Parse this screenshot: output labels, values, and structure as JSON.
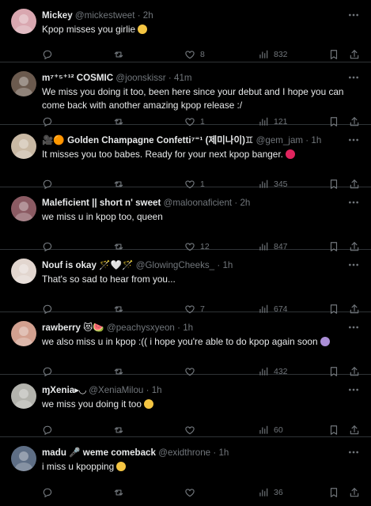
{
  "tweets": [
    {
      "name": "Mickey",
      "handle": "@mickestweet",
      "time": "2h",
      "text": "Kpop misses you girlie",
      "text_emoji": "pleading-face",
      "replies": "",
      "retweets": "",
      "likes": "8",
      "views": "832",
      "avatar_color": "#d9a7b0"
    },
    {
      "name": "m⁷⁺⁵⁺¹² COSMIC",
      "handle": "@joonskissr",
      "time": "41m",
      "text": "We miss you doing it too, been here since your debut and I hope you can come back with another amazing kpop release :/",
      "replies": "",
      "retweets": "",
      "likes": "1",
      "views": "121",
      "avatar_color": "#6b5a4e"
    },
    {
      "name": "🎥🟠 Golden Champagne Confetti⁷⁼¹ (제미나이)♊",
      "handle": "@gem_jam",
      "time": "1h",
      "text": "It misses you too babes. Ready for your next kpop banger.",
      "text_emoji": "heart-arrow",
      "replies": "",
      "retweets": "",
      "likes": "1",
      "views": "345",
      "avatar_color": "#c9b9a4"
    },
    {
      "name": "Maleficient || short n' sweet",
      "handle": "@maloonaficient",
      "time": "2h",
      "text": "we miss u in kpop too, queen",
      "replies": "",
      "retweets": "",
      "likes": "12",
      "views": "847",
      "avatar_color": "#8b5b63"
    },
    {
      "name": "Nouf is okay 🪄🤍🪄",
      "handle": "@GlowingCheeks_",
      "time": "1h",
      "text": "That's so sad to hear from you...",
      "replies": "",
      "retweets": "",
      "likes": "7",
      "views": "674",
      "avatar_color": "#e2d6cf"
    },
    {
      "name": "rawberry 😻🍉",
      "handle": "@peachysxyeon",
      "time": "1h",
      "text": "we also miss u in kpop :(( i hope you're able to do kpop again soon",
      "text_emoji": "purple-heart",
      "replies": "",
      "retweets": "",
      "likes": "",
      "views": "432",
      "avatar_color": "#d2a08f"
    },
    {
      "name": "ɱXenia▸◡",
      "handle": "@XeniaMilou",
      "time": "1h",
      "text": "we miss you doing it too",
      "text_emoji": "crying-face",
      "replies": "",
      "retweets": "",
      "likes": "",
      "views": "60",
      "avatar_color": "#b3b3ad"
    },
    {
      "name": "madu 🎤 weme comeback",
      "handle": "@exidthrone",
      "time": "1h",
      "text": "i miss u kpopping",
      "text_emoji": "relieved-face",
      "replies": "",
      "retweets": "",
      "likes": "",
      "views": "36",
      "avatar_color": "#5e6e85"
    }
  ],
  "colors": {
    "background": "#000000",
    "divider": "#2f3336",
    "primary_text": "#e7e9ea",
    "secondary_text": "#71767b"
  },
  "icons": [
    "reply-icon",
    "retweet-icon",
    "like-icon",
    "views-icon",
    "bookmark-icon",
    "share-icon",
    "more-icon"
  ]
}
